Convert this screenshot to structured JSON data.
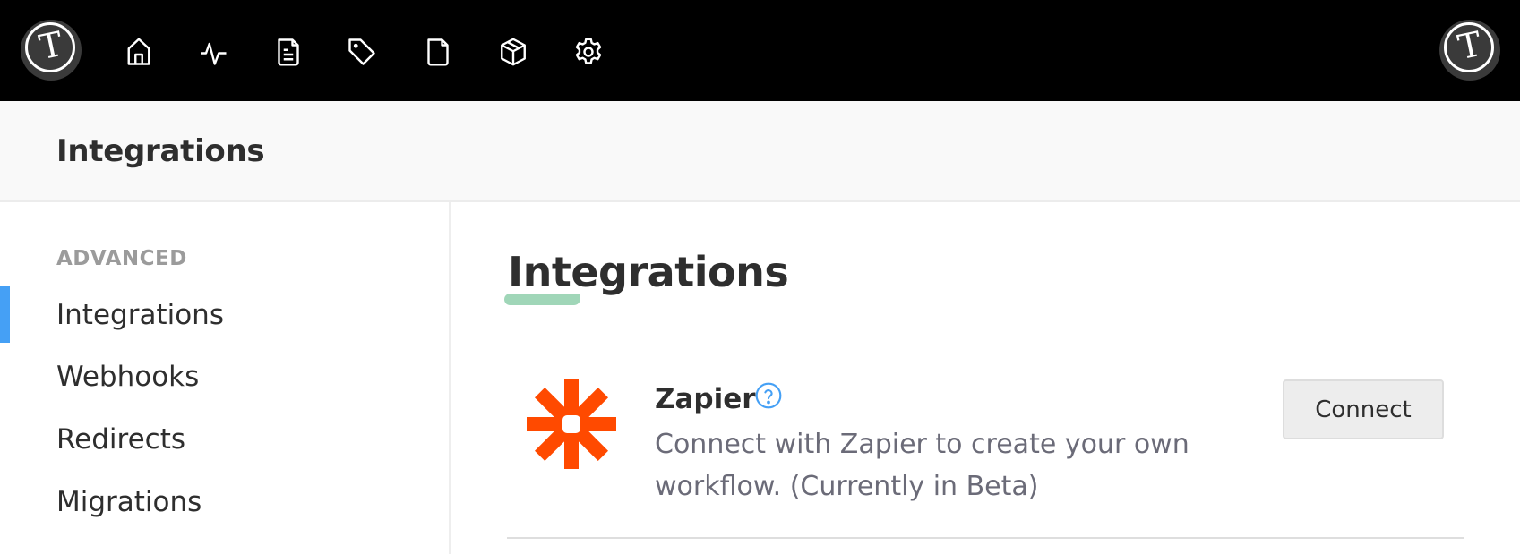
{
  "topnav": {
    "logo_glyph": "T",
    "items": [
      {
        "icon": "home-icon",
        "label": "Home"
      },
      {
        "icon": "activity-icon",
        "label": "Activity"
      },
      {
        "icon": "document-icon",
        "label": "Posts"
      },
      {
        "icon": "tag-icon",
        "label": "Tags"
      },
      {
        "icon": "file-icon",
        "label": "Pages"
      },
      {
        "icon": "box-icon",
        "label": "Products"
      },
      {
        "icon": "gear-icon",
        "label": "Settings"
      }
    ],
    "account_glyph": "T"
  },
  "page": {
    "title": "Integrations"
  },
  "sidebar": {
    "section_label": "ADVANCED",
    "items": [
      {
        "label": "Integrations",
        "active": true
      },
      {
        "label": "Webhooks",
        "active": false
      },
      {
        "label": "Redirects",
        "active": false
      },
      {
        "label": "Migrations",
        "active": false
      }
    ],
    "accent_color": "#45a0f5"
  },
  "main": {
    "title": "Integrations",
    "title_accent_color": "#a0d6b8",
    "integrations": [
      {
        "name": "Zapier",
        "logo_icon": "zapier-logo-icon",
        "brand_color": "#ff4a00",
        "help_icon": "question-circle-icon",
        "description_line1": "Connect with Zapier to create your own",
        "description_line2": "workflow. (Currently in Beta)",
        "action_label": "Connect"
      }
    ]
  }
}
